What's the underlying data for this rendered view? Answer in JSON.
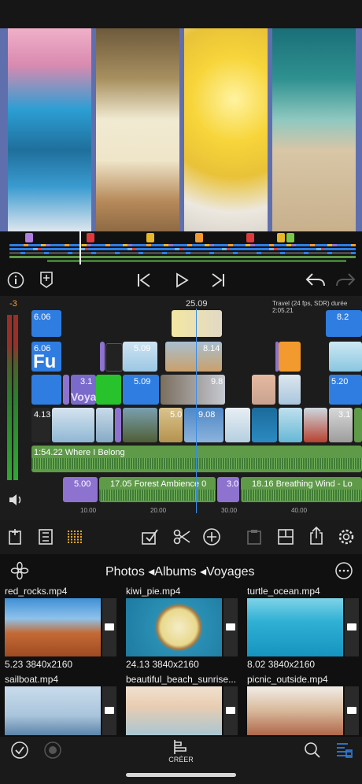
{
  "timeline": {
    "playhead_time": "25.09",
    "project_info": "Travel (24 fps, SDR) durée 2:05.21",
    "audio_level": "-3",
    "clips": {
      "v1": "6.06",
      "v2": "6.06",
      "fu": "Fu",
      "c509a": "5.09",
      "c814": "8.14",
      "c31": "3.1",
      "voya": "Voya",
      "c509b": "5.09",
      "c98": "9.8",
      "c52": "5.20",
      "c82": "8.2",
      "c413": "4.13",
      "c50": "5.0",
      "c908": "9.08",
      "c31b": "3.1"
    },
    "music_track": "1:54.22  Where I Belong",
    "audio2_a": "5.00",
    "audio2_b": "17.05  Forest Ambience 0",
    "audio2_c": "3.0",
    "audio2_d": "18.16  Breathing Wind - Lo",
    "ruler": [
      "10.00",
      "20.00",
      "30.00",
      "40.00"
    ]
  },
  "browser": {
    "breadcrumb": "Photos ◂Albums ◂Voyages",
    "files": [
      {
        "name": "red_rocks.mp4",
        "info": "5.23  3840x2160"
      },
      {
        "name": "kiwi_pie.mp4",
        "info": "24.13  3840x2160"
      },
      {
        "name": "turtle_ocean.mp4",
        "info": "8.02  3840x2160"
      },
      {
        "name": "sailboat.mp4",
        "info": ""
      },
      {
        "name": "beautiful_beach_sunrise...",
        "info": ""
      },
      {
        "name": "picnic_outside.mp4",
        "info": ""
      }
    ]
  },
  "bottom": {
    "create_label": "CRÉER"
  },
  "colors": {
    "accent_blue": "#2f7de1",
    "audio_green": "#5e9a48",
    "purple": "#8d73cf",
    "orange": "#f29a2e"
  }
}
